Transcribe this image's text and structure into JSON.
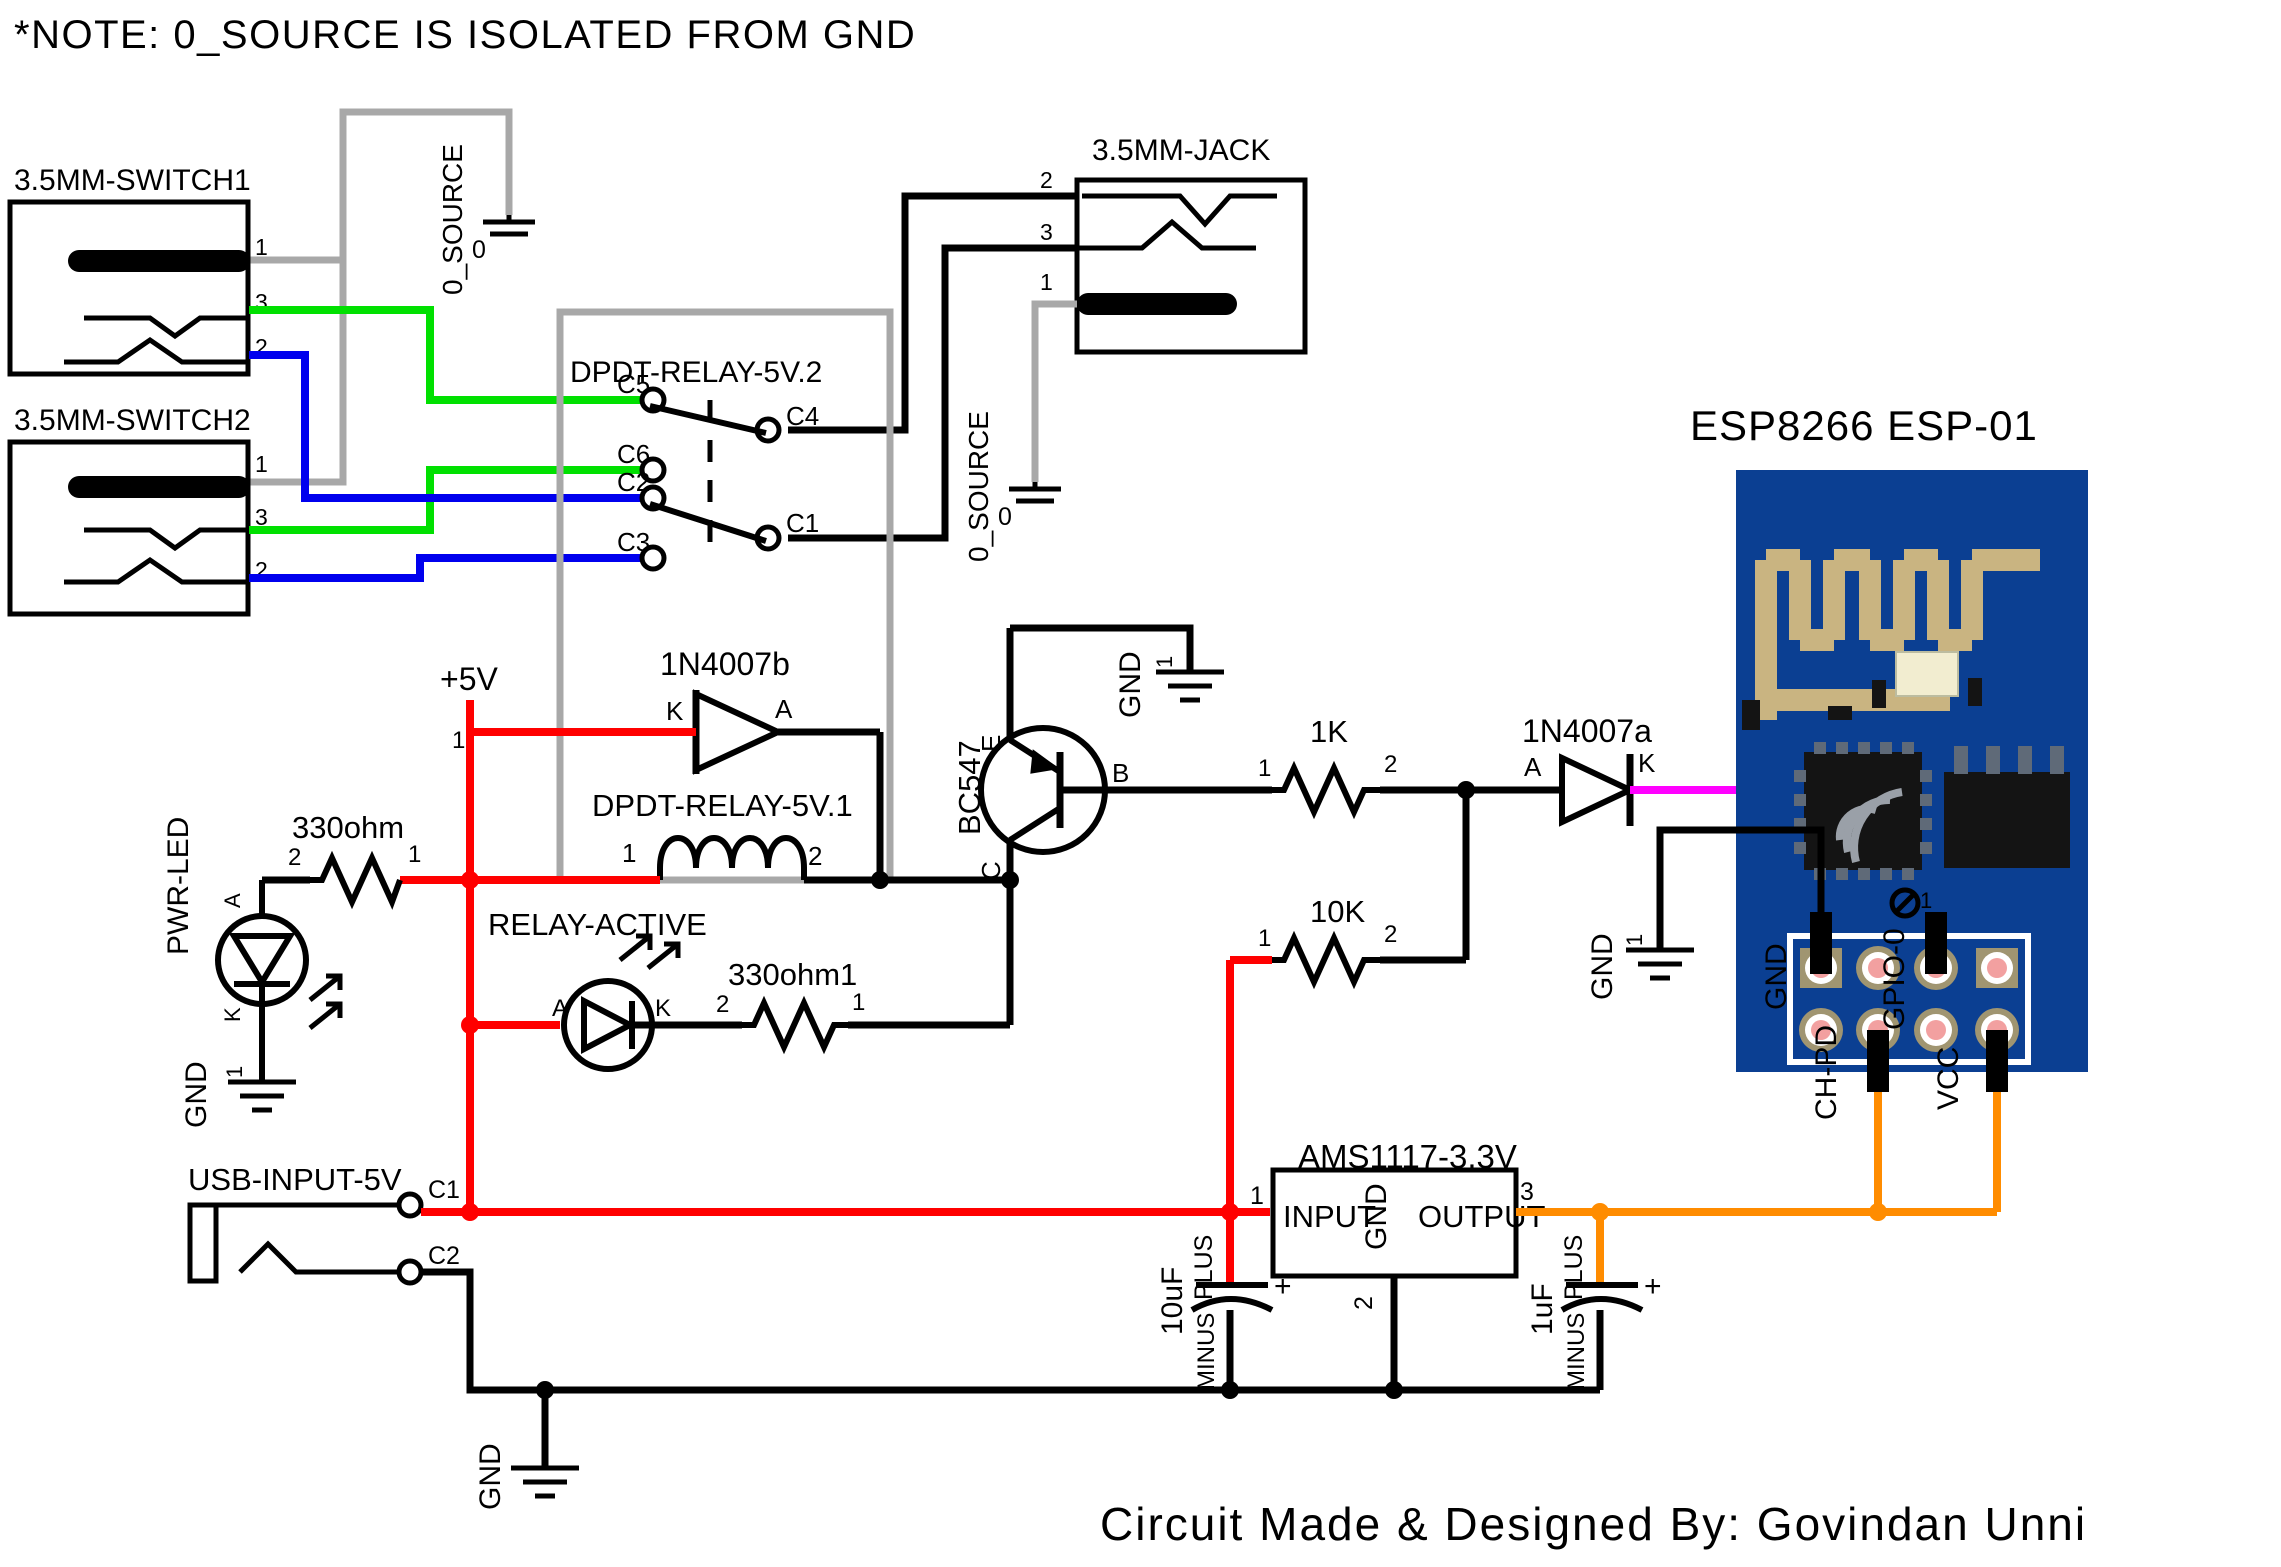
{
  "sheet": {
    "title_note": "*NOTE: 0_SOURCE IS ISOLATED FROM GND",
    "credit": "Circuit Made & Designed By: Govindan Unni",
    "module_title": "ESP8266 ESP-01"
  },
  "colors": {
    "note_red": "#ff0000",
    "wire_red": "#ff0000",
    "wire_green": "#00e000",
    "wire_blue": "#0000ee",
    "wire_black": "#000000",
    "wire_grey": "#a8a8a8",
    "wire_orange": "#ff8c00",
    "wire_magenta": "#ff00ff",
    "pcb_blue": "#0b3f92",
    "pcb_trace": "#c9b481",
    "pcb_black": "#141414",
    "pcb_pad": "#f2a0a0",
    "pcb_shield": "#f2edd0"
  },
  "components": {
    "switch1": {
      "name": "3.5MM-SWITCH1",
      "pins": [
        "1",
        "3",
        "2"
      ]
    },
    "switch2": {
      "name": "3.5MM-SWITCH2",
      "pins": [
        "1",
        "3",
        "2"
      ]
    },
    "jack": {
      "name": "3.5MM-JACK",
      "pins": [
        "2",
        "3",
        "1"
      ]
    },
    "relay_contacts": {
      "name": "DPDT-RELAY-5V.2",
      "pins": [
        "C5",
        "C4",
        "C6",
        "C2",
        "C1",
        "C3"
      ]
    },
    "relay_coil": {
      "name": "DPDT-RELAY-5V.1",
      "pins": [
        "1",
        "2"
      ]
    },
    "diode_b": {
      "name": "1N4007b",
      "cathode": "K",
      "anode": "A"
    },
    "diode_a": {
      "name": "1N4007a",
      "anode": "A",
      "cathode": "K"
    },
    "transistor": {
      "name": "BC547",
      "pins": [
        "E",
        "B",
        "C"
      ]
    },
    "r_330": {
      "name": "330ohm",
      "pins": [
        "2",
        "1"
      ]
    },
    "r_330_1": {
      "name": "330ohm1",
      "pins": [
        "2",
        "1"
      ]
    },
    "r_1k": {
      "name": "1K",
      "pins": [
        "1",
        "2"
      ]
    },
    "r_10k": {
      "name": "10K",
      "pins": [
        "1",
        "2"
      ]
    },
    "pwr_led": {
      "name": "PWR-LED",
      "anode": "A",
      "cathode": "K"
    },
    "relay_active_led": {
      "name": "RELAY-ACTIVE",
      "anode": "A",
      "cathode": "K"
    },
    "regulator": {
      "name": "AMS1117-3.3V",
      "input": "INPUT",
      "output": "OUTPUT",
      "gnd": "GND",
      "pins": [
        "1",
        "2",
        "3"
      ]
    },
    "cap_10uf": {
      "name": "10uF",
      "plus": "PLUS",
      "minus": "MINUS",
      "sign": "+"
    },
    "cap_1uf": {
      "name": "1uF",
      "plus": "PLUS",
      "minus": "MINUS",
      "sign": "+"
    },
    "usb": {
      "name": "USB-INPUT-5V",
      "pins": [
        "C1",
        "C2"
      ]
    },
    "esp": {
      "name": "ESP8266 ESP-01",
      "pins": [
        "GND",
        "GPIO-0",
        "CH-PD",
        "VCC"
      ]
    }
  },
  "nets": {
    "plus5v": "+5V",
    "gnd": "GND",
    "zero_source": "0_SOURCE",
    "zero_label": "0",
    "gnd_pin": "1"
  },
  "labels": {
    "gnd_left_led": "GND",
    "gnd_transistor": "GND",
    "gnd_esp": "GND",
    "gnd_bottom": "GND",
    "source_left": "0_SOURCE",
    "source_right": "0_SOURCE"
  }
}
